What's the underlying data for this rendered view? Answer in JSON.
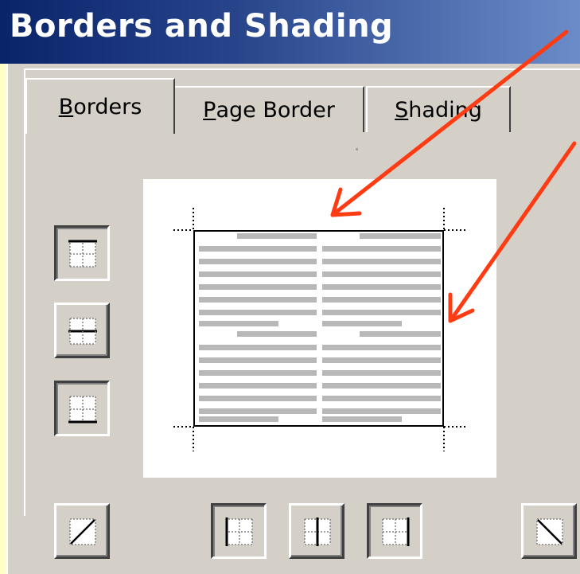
{
  "dialog": {
    "title": "Borders and Shading"
  },
  "tabs": [
    {
      "underline": "B",
      "rest": "orders",
      "active": true
    },
    {
      "underline": "P",
      "rest": "age Border",
      "active": false
    },
    {
      "underline": "S",
      "rest": "hading",
      "active": false
    }
  ],
  "icons": {
    "top_border": "top-border-icon",
    "middle_border": "inside-horizontal-border-icon",
    "bottom_border": "bottom-border-icon",
    "diag_up": "diagonal-up-border-icon",
    "left_border": "left-border-icon",
    "inside_vertical": "inside-vertical-border-icon",
    "right_border": "right-border-icon",
    "diag_down": "diagonal-down-border-icon"
  },
  "colors": {
    "title_bar": "#0a246a",
    "dialog_bg": "#d4d0c8",
    "annotation_arrow": "#ff3b14",
    "preview_text_lines": "#b8b8b8"
  }
}
